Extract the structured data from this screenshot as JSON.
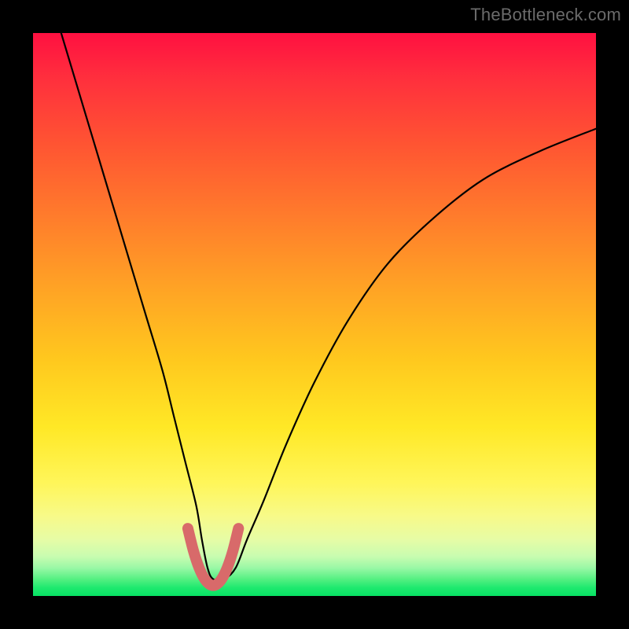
{
  "watermark": "TheBottleneck.com",
  "chart_data": {
    "type": "line",
    "title": "",
    "xlabel": "",
    "ylabel": "",
    "xlim": [
      0,
      100
    ],
    "ylim": [
      0,
      100
    ],
    "grid": false,
    "legend": false,
    "annotations": [],
    "series": [
      {
        "name": "bottleneck-curve-black",
        "color": "#000000",
        "x": [
          5,
          8,
          11,
          14,
          17,
          20,
          23,
          25,
          27,
          29,
          30,
          31,
          32,
          34,
          36,
          38,
          41,
          45,
          50,
          56,
          63,
          71,
          80,
          90,
          100
        ],
        "y": [
          100,
          90,
          80,
          70,
          60,
          50,
          40,
          32,
          24,
          16,
          10,
          5,
          3,
          3,
          5,
          10,
          17,
          27,
          38,
          49,
          59,
          67,
          74,
          79,
          83
        ]
      },
      {
        "name": "bottleneck-valley-highlight",
        "color": "#d86a6a",
        "x": [
          27.5,
          28.5,
          29.5,
          30.5,
          31.5,
          32.5,
          33.5,
          34.5,
          35.5,
          36.5
        ],
        "y": [
          12,
          8,
          5,
          3,
          2,
          2,
          3,
          5,
          8,
          12
        ]
      }
    ],
    "background_gradient": {
      "stops": [
        {
          "pos": 0.0,
          "color": "#ff1041"
        },
        {
          "pos": 0.08,
          "color": "#ff2f3d"
        },
        {
          "pos": 0.2,
          "color": "#ff5532"
        },
        {
          "pos": 0.32,
          "color": "#ff7a2c"
        },
        {
          "pos": 0.45,
          "color": "#ffa225"
        },
        {
          "pos": 0.58,
          "color": "#ffc81e"
        },
        {
          "pos": 0.7,
          "color": "#ffe826"
        },
        {
          "pos": 0.8,
          "color": "#fff65a"
        },
        {
          "pos": 0.86,
          "color": "#f7fa8a"
        },
        {
          "pos": 0.9,
          "color": "#e6fca6"
        },
        {
          "pos": 0.93,
          "color": "#c8fcb0"
        },
        {
          "pos": 0.95,
          "color": "#9af8a6"
        },
        {
          "pos": 0.97,
          "color": "#55f082"
        },
        {
          "pos": 0.985,
          "color": "#1fe96f"
        },
        {
          "pos": 1.0,
          "color": "#07e263"
        }
      ]
    }
  }
}
